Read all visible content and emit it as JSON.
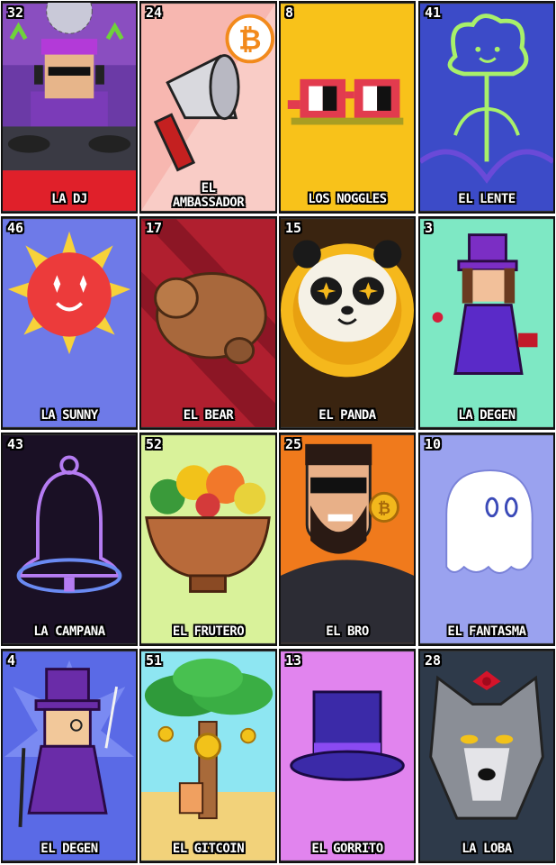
{
  "cards": [
    {
      "number": "32",
      "title": "LA DJ",
      "art": "dj-icon",
      "colors": {
        "bg": "#6b3aa6",
        "accent": "#e0202a"
      }
    },
    {
      "number": "24",
      "title": "EL\nAMBASSADOR",
      "art": "megaphone-icon",
      "colors": {
        "bg": "#f7b7b0",
        "accent": "#f28a1c"
      }
    },
    {
      "number": "8",
      "title": "LOS NOGGLES",
      "art": "noggles-icon",
      "colors": {
        "bg": "#f8c21a",
        "accent": "#e23b4e"
      }
    },
    {
      "number": "41",
      "title": "EL LENTE",
      "art": "lente-icon",
      "colors": {
        "bg": "#3c4bc8",
        "accent": "#a8f06a"
      }
    },
    {
      "number": "46",
      "title": "LA  SUNNY",
      "art": "sun-icon",
      "colors": {
        "bg": "#6e7ae8",
        "accent": "#ec3b3b"
      }
    },
    {
      "number": "17",
      "title": "EL BEAR",
      "art": "bear-icon",
      "colors": {
        "bg": "#b01f2f",
        "accent": "#a8683c"
      }
    },
    {
      "number": "15",
      "title": "EL PANDA",
      "art": "panda-coin-icon",
      "colors": {
        "bg": "#3a2410",
        "accent": "#f5b81c"
      }
    },
    {
      "number": "3",
      "title": "LA DEGEN",
      "art": "lady-degen-icon",
      "colors": {
        "bg": "#7ee8c4",
        "accent": "#7b2ec4"
      }
    },
    {
      "number": "43",
      "title": "LA CAMPANA",
      "art": "bell-icon",
      "colors": {
        "bg": "#1a1025",
        "accent": "#b57cf2"
      }
    },
    {
      "number": "52",
      "title": "EL FRUTERO",
      "art": "fruit-bowl-icon",
      "colors": {
        "bg": "#d9f29a",
        "accent": "#b86a3a"
      }
    },
    {
      "number": "25",
      "title": "EL BRO",
      "art": "bro-icon",
      "colors": {
        "bg": "#f07a1c",
        "accent": "#2c2c34"
      }
    },
    {
      "number": "10",
      "title": "EL FANTASMA",
      "art": "ghost-icon",
      "colors": {
        "bg": "#9aa2ef",
        "accent": "#ffffff"
      }
    },
    {
      "number": "4",
      "title": "EL DEGEN",
      "art": "top-hat-gentleman-icon",
      "colors": {
        "bg": "#5a6ae6",
        "accent": "#6a2ca8"
      }
    },
    {
      "number": "51",
      "title": "EL GITCOIN",
      "art": "coin-tree-icon",
      "colors": {
        "bg": "#8ee6f2",
        "accent": "#2f9a3a"
      }
    },
    {
      "number": "13",
      "title": "EL GORRITO",
      "art": "top-hat-icon",
      "colors": {
        "bg": "#e184ee",
        "accent": "#3b2aa8"
      }
    },
    {
      "number": "28",
      "title": "LA LOBA",
      "art": "wolf-icon",
      "colors": {
        "bg": "#2e3a4a",
        "accent": "#d4142a"
      }
    }
  ]
}
